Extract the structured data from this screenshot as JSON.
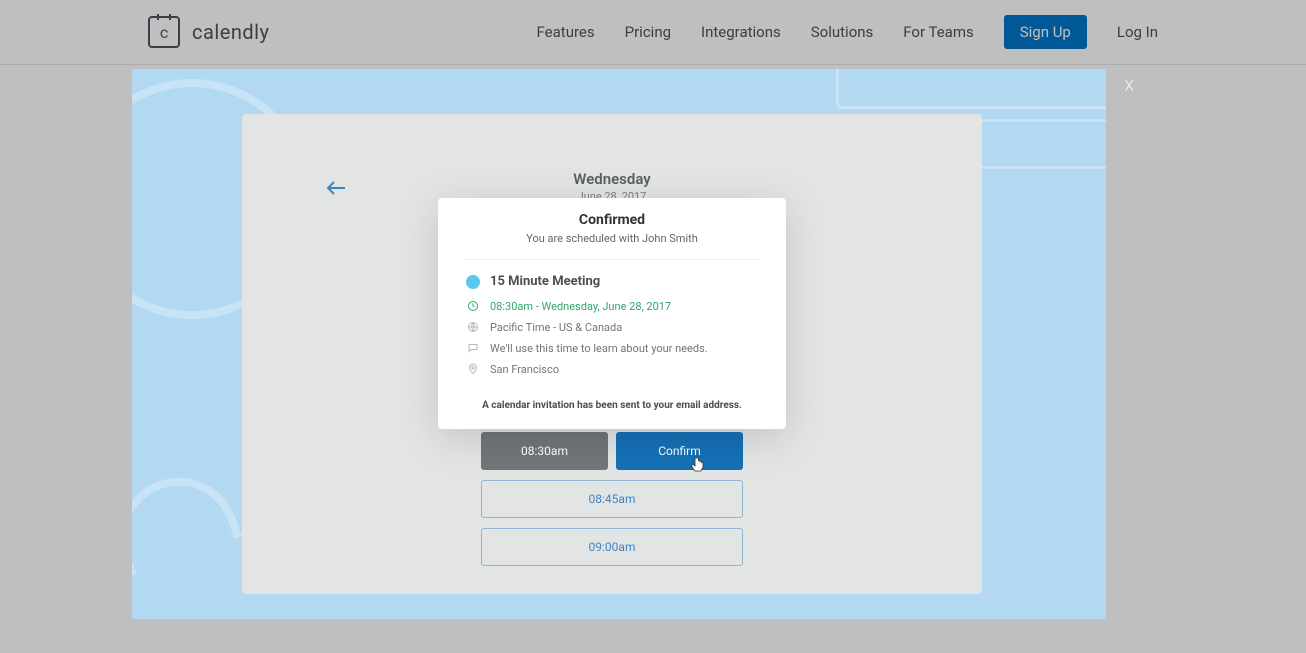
{
  "nav": {
    "brand": "calendly",
    "links": {
      "features": "Features",
      "pricing": "Pricing",
      "integrations": "Integrations",
      "solutions": "Solutions",
      "teams": "For Teams",
      "signup": "Sign Up",
      "login": "Log In"
    }
  },
  "modal_close": "x",
  "scheduler": {
    "day_name": "Wednesday",
    "day_date": "June 28, 2017",
    "slot_selected": "08:30am",
    "confirm_label": "Confirm",
    "slot_next1": "08:45am",
    "slot_next2": "09:00am"
  },
  "confirmation": {
    "title": "Confirmed",
    "sub": "You are scheduled with John Smith",
    "meeting_title": "15 Minute Meeting",
    "datetime": "08:30am - Wednesday, June 28, 2017",
    "timezone": "Pacific Time - US & Canada",
    "note": "We'll use this time to learn about your needs.",
    "location": "San Francisco",
    "footer": "A calendar invitation has been sent to your email address."
  },
  "logo_letter": "c"
}
